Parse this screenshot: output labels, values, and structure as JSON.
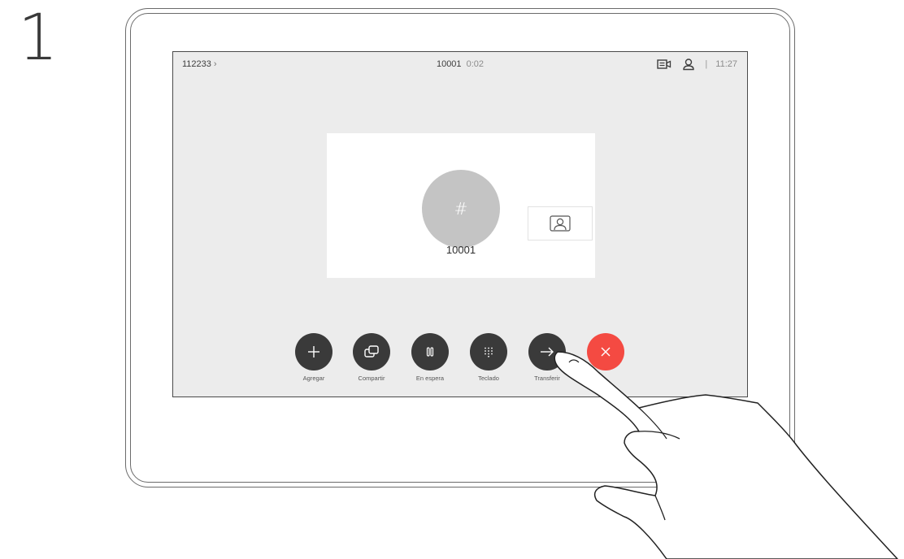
{
  "step": {
    "number": "1"
  },
  "topbar": {
    "contact_id": "112233",
    "chevron": "›",
    "call_number": "10001",
    "call_duration": "0:02",
    "camera_icon": "camera-icon",
    "user_icon": "user-icon",
    "separator": "|",
    "time": "11:27"
  },
  "call": {
    "avatar_symbol": "#",
    "number": "10001",
    "selfview_icon": "person-icon"
  },
  "controls": [
    {
      "label": "Agregar",
      "icon": "plus-icon"
    },
    {
      "label": "Compartir",
      "icon": "share-icon"
    },
    {
      "label": "En espera",
      "icon": "pause-icon"
    },
    {
      "label": "Teclado",
      "icon": "keypad-icon"
    },
    {
      "label": "Transferir",
      "icon": "arrow-right-icon"
    },
    {
      "label": "",
      "icon": "close-icon"
    }
  ],
  "colors": {
    "screen_bg": "#ececec",
    "button_dark": "#3a3a3a",
    "end_call": "#f44a42",
    "avatar": "#c4c4c4"
  }
}
